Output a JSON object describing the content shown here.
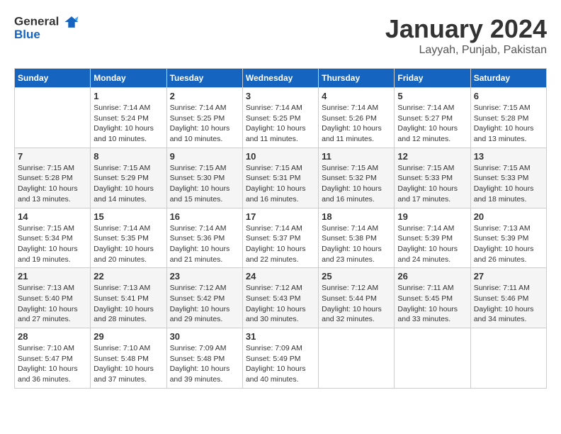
{
  "header": {
    "logo_general": "General",
    "logo_blue": "Blue",
    "title": "January 2024",
    "subtitle": "Layyah, Punjab, Pakistan"
  },
  "columns": [
    "Sunday",
    "Monday",
    "Tuesday",
    "Wednesday",
    "Thursday",
    "Friday",
    "Saturday"
  ],
  "weeks": [
    [
      {
        "day": "",
        "info": ""
      },
      {
        "day": "1",
        "info": "Sunrise: 7:14 AM\nSunset: 5:24 PM\nDaylight: 10 hours and 10 minutes."
      },
      {
        "day": "2",
        "info": "Sunrise: 7:14 AM\nSunset: 5:25 PM\nDaylight: 10 hours and 10 minutes."
      },
      {
        "day": "3",
        "info": "Sunrise: 7:14 AM\nSunset: 5:25 PM\nDaylight: 10 hours and 11 minutes."
      },
      {
        "day": "4",
        "info": "Sunrise: 7:14 AM\nSunset: 5:26 PM\nDaylight: 10 hours and 11 minutes."
      },
      {
        "day": "5",
        "info": "Sunrise: 7:14 AM\nSunset: 5:27 PM\nDaylight: 10 hours and 12 minutes."
      },
      {
        "day": "6",
        "info": "Sunrise: 7:15 AM\nSunset: 5:28 PM\nDaylight: 10 hours and 13 minutes."
      }
    ],
    [
      {
        "day": "7",
        "info": "Sunrise: 7:15 AM\nSunset: 5:28 PM\nDaylight: 10 hours and 13 minutes."
      },
      {
        "day": "8",
        "info": "Sunrise: 7:15 AM\nSunset: 5:29 PM\nDaylight: 10 hours and 14 minutes."
      },
      {
        "day": "9",
        "info": "Sunrise: 7:15 AM\nSunset: 5:30 PM\nDaylight: 10 hours and 15 minutes."
      },
      {
        "day": "10",
        "info": "Sunrise: 7:15 AM\nSunset: 5:31 PM\nDaylight: 10 hours and 16 minutes."
      },
      {
        "day": "11",
        "info": "Sunrise: 7:15 AM\nSunset: 5:32 PM\nDaylight: 10 hours and 16 minutes."
      },
      {
        "day": "12",
        "info": "Sunrise: 7:15 AM\nSunset: 5:33 PM\nDaylight: 10 hours and 17 minutes."
      },
      {
        "day": "13",
        "info": "Sunrise: 7:15 AM\nSunset: 5:33 PM\nDaylight: 10 hours and 18 minutes."
      }
    ],
    [
      {
        "day": "14",
        "info": "Sunrise: 7:15 AM\nSunset: 5:34 PM\nDaylight: 10 hours and 19 minutes."
      },
      {
        "day": "15",
        "info": "Sunrise: 7:14 AM\nSunset: 5:35 PM\nDaylight: 10 hours and 20 minutes."
      },
      {
        "day": "16",
        "info": "Sunrise: 7:14 AM\nSunset: 5:36 PM\nDaylight: 10 hours and 21 minutes."
      },
      {
        "day": "17",
        "info": "Sunrise: 7:14 AM\nSunset: 5:37 PM\nDaylight: 10 hours and 22 minutes."
      },
      {
        "day": "18",
        "info": "Sunrise: 7:14 AM\nSunset: 5:38 PM\nDaylight: 10 hours and 23 minutes."
      },
      {
        "day": "19",
        "info": "Sunrise: 7:14 AM\nSunset: 5:39 PM\nDaylight: 10 hours and 24 minutes."
      },
      {
        "day": "20",
        "info": "Sunrise: 7:13 AM\nSunset: 5:39 PM\nDaylight: 10 hours and 26 minutes."
      }
    ],
    [
      {
        "day": "21",
        "info": "Sunrise: 7:13 AM\nSunset: 5:40 PM\nDaylight: 10 hours and 27 minutes."
      },
      {
        "day": "22",
        "info": "Sunrise: 7:13 AM\nSunset: 5:41 PM\nDaylight: 10 hours and 28 minutes."
      },
      {
        "day": "23",
        "info": "Sunrise: 7:12 AM\nSunset: 5:42 PM\nDaylight: 10 hours and 29 minutes."
      },
      {
        "day": "24",
        "info": "Sunrise: 7:12 AM\nSunset: 5:43 PM\nDaylight: 10 hours and 30 minutes."
      },
      {
        "day": "25",
        "info": "Sunrise: 7:12 AM\nSunset: 5:44 PM\nDaylight: 10 hours and 32 minutes."
      },
      {
        "day": "26",
        "info": "Sunrise: 7:11 AM\nSunset: 5:45 PM\nDaylight: 10 hours and 33 minutes."
      },
      {
        "day": "27",
        "info": "Sunrise: 7:11 AM\nSunset: 5:46 PM\nDaylight: 10 hours and 34 minutes."
      }
    ],
    [
      {
        "day": "28",
        "info": "Sunrise: 7:10 AM\nSunset: 5:47 PM\nDaylight: 10 hours and 36 minutes."
      },
      {
        "day": "29",
        "info": "Sunrise: 7:10 AM\nSunset: 5:48 PM\nDaylight: 10 hours and 37 minutes."
      },
      {
        "day": "30",
        "info": "Sunrise: 7:09 AM\nSunset: 5:48 PM\nDaylight: 10 hours and 39 minutes."
      },
      {
        "day": "31",
        "info": "Sunrise: 7:09 AM\nSunset: 5:49 PM\nDaylight: 10 hours and 40 minutes."
      },
      {
        "day": "",
        "info": ""
      },
      {
        "day": "",
        "info": ""
      },
      {
        "day": "",
        "info": ""
      }
    ]
  ]
}
